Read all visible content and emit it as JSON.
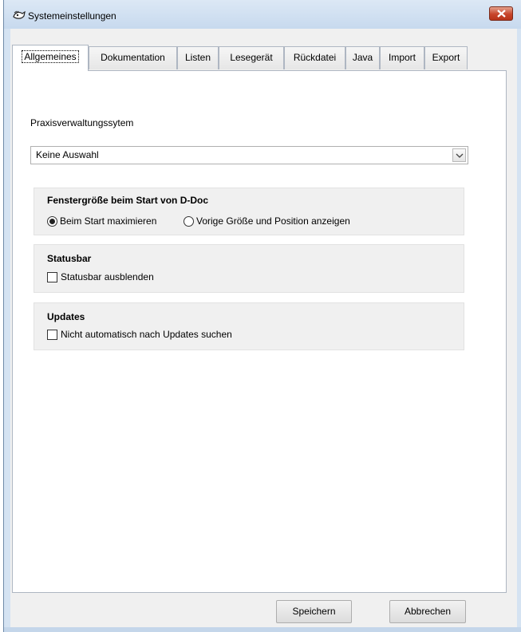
{
  "window": {
    "title": "Systemeinstellungen"
  },
  "tabs": [
    {
      "label": "Allgemeines",
      "active": true
    },
    {
      "label": "Dokumentation",
      "active": false
    },
    {
      "label": "Listen",
      "active": false
    },
    {
      "label": "Lesegerät",
      "active": false
    },
    {
      "label": "Rückdatei",
      "active": false
    },
    {
      "label": "Java",
      "active": false
    },
    {
      "label": "Import",
      "active": false
    },
    {
      "label": "Export",
      "active": false
    }
  ],
  "general": {
    "pvs_label": "Praxisverwaltungssytem",
    "pvs_value": "Keine Auswahl",
    "window_size_group": {
      "title": "Fenstergröße beim Start von D-Doc",
      "option_maximize": "Beim Start maximieren",
      "option_previous": "Vorige Größe und Position anzeigen",
      "selected": "Beim Start maximieren"
    },
    "statusbar_group": {
      "title": "Statusbar",
      "checkbox_label": "Statusbar ausblenden",
      "checked": false
    },
    "updates_group": {
      "title": "Updates",
      "checkbox_label": "Nicht automatisch nach Updates suchen",
      "checked": false
    }
  },
  "footer": {
    "save_label": "Speichern",
    "cancel_label": "Abbrechen"
  },
  "colors": {
    "window_frame": "#d5e3f2",
    "close_button": "#c7452a",
    "group_background": "#f0f0f0"
  },
  "icons": {
    "app": "app-icon",
    "close": "close-icon",
    "dropdown": "chevron-down-icon"
  }
}
